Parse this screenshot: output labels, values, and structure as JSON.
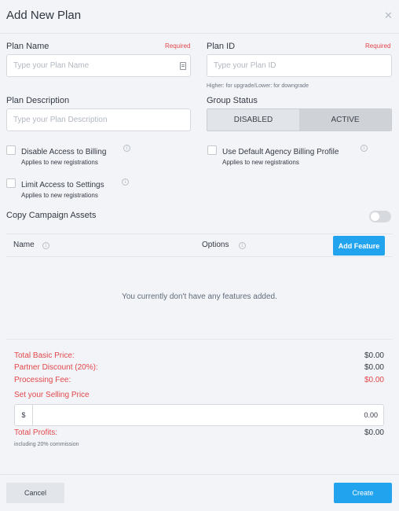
{
  "header": {
    "title": "Add New Plan"
  },
  "form": {
    "plan_name": {
      "label": "Plan Name",
      "required": "Required",
      "placeholder": "Type your Plan Name"
    },
    "plan_id": {
      "label": "Plan ID",
      "required": "Required",
      "placeholder": "Type your Plan ID",
      "hint": "Higher: for upgrade/Lower: for downgrade"
    },
    "plan_description": {
      "label": "Plan Description",
      "placeholder": "Type your Plan Description"
    },
    "group_status": {
      "label": "Group Status",
      "options": [
        "DISABLED",
        "ACTIVE"
      ],
      "selected": "ACTIVE"
    },
    "checkboxes": [
      {
        "title": "Disable Access to Billing",
        "subtitle": "Applies to new registrations",
        "checked": false
      },
      {
        "title": "Use Default Agency Billing Profile",
        "subtitle": "Applies to new registrations",
        "checked": false
      },
      {
        "title": "Limit Access to Settings",
        "subtitle": "Applies to new registrations",
        "checked": false
      }
    ],
    "copy_assets": {
      "label": "Copy Campaign Assets",
      "on": false
    }
  },
  "features": {
    "columns": [
      "Name",
      "Options"
    ],
    "add_label": "Add Feature",
    "empty_text": "You currently don't have any features added."
  },
  "pricing": {
    "total_basic": {
      "label": "Total Basic Price:",
      "value": "$0.00"
    },
    "partner_discount": {
      "label": "Partner Discount (20%):",
      "value": "$0.00"
    },
    "processing_fee": {
      "label": "Processing Fee:",
      "value": "$0.00"
    },
    "selling_label": "Set your Selling Price",
    "currency": "$",
    "selling_value": "0.00",
    "total_profits": {
      "label": "Total Profits:",
      "value": "$0.00"
    },
    "commission_note": "including 20% commission"
  },
  "footer": {
    "cancel": "Cancel",
    "create": "Create"
  },
  "colors": {
    "accent": "#22a3ee",
    "danger": "#e2474b"
  }
}
